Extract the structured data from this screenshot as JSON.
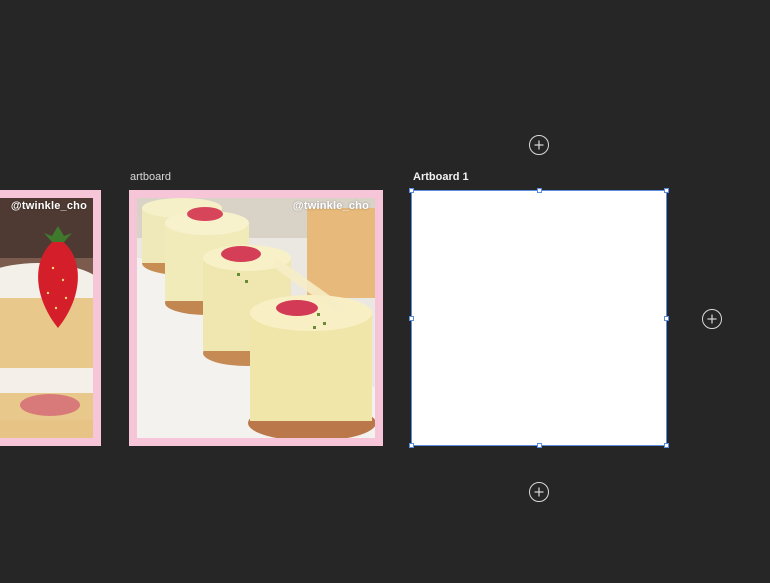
{
  "artboards": [
    {
      "label": "",
      "watermark": "@twinkle_cho"
    },
    {
      "label": "artboard",
      "watermark": "@twinkle_cho"
    },
    {
      "label": "Artboard 1",
      "watermark": ""
    }
  ],
  "add_buttons": [
    "add-artboard-above",
    "add-artboard-right",
    "add-artboard-below"
  ],
  "colors": {
    "canvas": "#262626",
    "selection": "#5b8ee0",
    "artboard_border": "#f6c6d8"
  },
  "icons": [
    "plus-circle-icon"
  ]
}
